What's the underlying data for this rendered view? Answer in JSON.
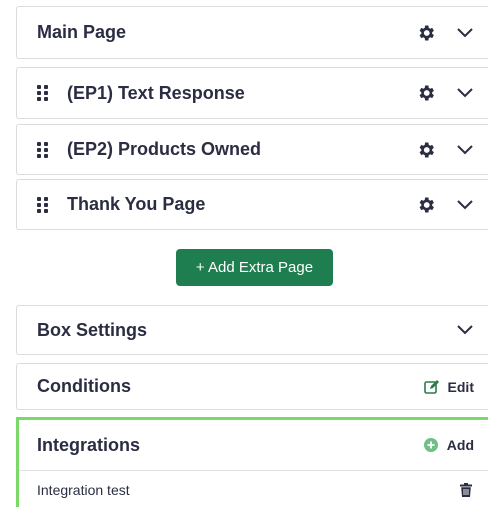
{
  "pages": [
    {
      "label": "Main Page",
      "draggable": false,
      "icon_settings": "gear-icon",
      "icon_toggle": "chevron-down-icon"
    },
    {
      "label": "(EP1) Text Response",
      "draggable": true,
      "icon_settings": "gear-icon",
      "icon_toggle": "chevron-down-icon"
    },
    {
      "label": "(EP2) Products Owned",
      "draggable": true,
      "icon_settings": "gear-icon",
      "icon_toggle": "chevron-down-icon"
    },
    {
      "label": "Thank You Page",
      "draggable": true,
      "icon_settings": "gear-icon",
      "icon_toggle": "chevron-down-icon"
    }
  ],
  "add_extra_page": {
    "label": "+ Add Extra Page",
    "color": "#1f7e4f"
  },
  "box_settings": {
    "label": "Box Settings",
    "icon": "chevron-down-icon"
  },
  "conditions": {
    "label": "Conditions",
    "action_label": "Edit",
    "action_icon": "edit-icon"
  },
  "integrations": {
    "label": "Integrations",
    "action_label": "Add",
    "action_icon": "plus-circle-icon",
    "accent_color": "#7bd96a",
    "items": [
      {
        "label": "Integration test",
        "icon": "trash-icon"
      }
    ]
  }
}
